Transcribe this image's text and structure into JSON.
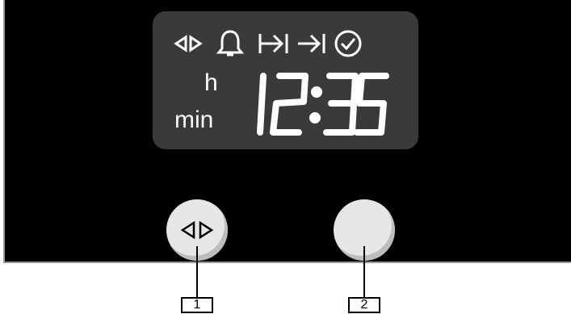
{
  "display": {
    "units": {
      "hours": "h",
      "minutes": "min"
    },
    "time": "12:35",
    "icons": [
      "left-right-arrows-icon",
      "bell-icon",
      "duration-icon",
      "end-time-icon",
      "clock-check-icon"
    ]
  },
  "controls": [
    {
      "label": "1",
      "symbol": "left-right-arrows-icon"
    },
    {
      "label": "2",
      "symbol": ""
    }
  ]
}
